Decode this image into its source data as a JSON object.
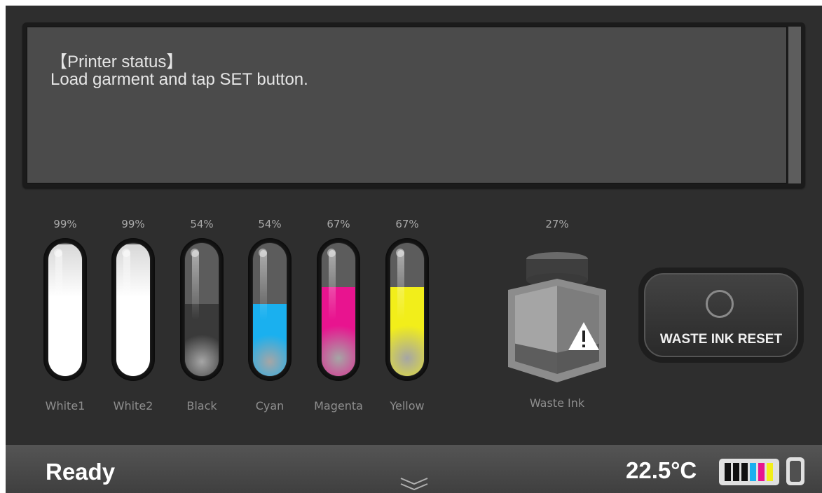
{
  "status": {
    "title": "【Printer status】",
    "message": "Load garment and tap SET button."
  },
  "inks": [
    {
      "name": "White1",
      "percent_label": "99%",
      "percent": 99,
      "color": "#ffffff"
    },
    {
      "name": "White2",
      "percent_label": "99%",
      "percent": 99,
      "color": "#ffffff"
    },
    {
      "name": "Black",
      "percent_label": "54%",
      "percent": 54,
      "color": "#3a3a3a"
    },
    {
      "name": "Cyan",
      "percent_label": "54%",
      "percent": 54,
      "color": "#1ab0ef"
    },
    {
      "name": "Magenta",
      "percent_label": "67%",
      "percent": 67,
      "color": "#e8148f"
    },
    {
      "name": "Yellow",
      "percent_label": "67%",
      "percent": 67,
      "color": "#f2ee1a"
    }
  ],
  "waste_ink": {
    "name": "Waste Ink",
    "percent_label": "27%",
    "percent": 27,
    "icon": "warning-icon"
  },
  "waste_reset": {
    "label": "WASTE INK RESET",
    "icon": "circle-icon"
  },
  "bottom": {
    "status": "Ready",
    "temperature": "22.5°C",
    "expand_icon": "chevron-down-icon"
  }
}
